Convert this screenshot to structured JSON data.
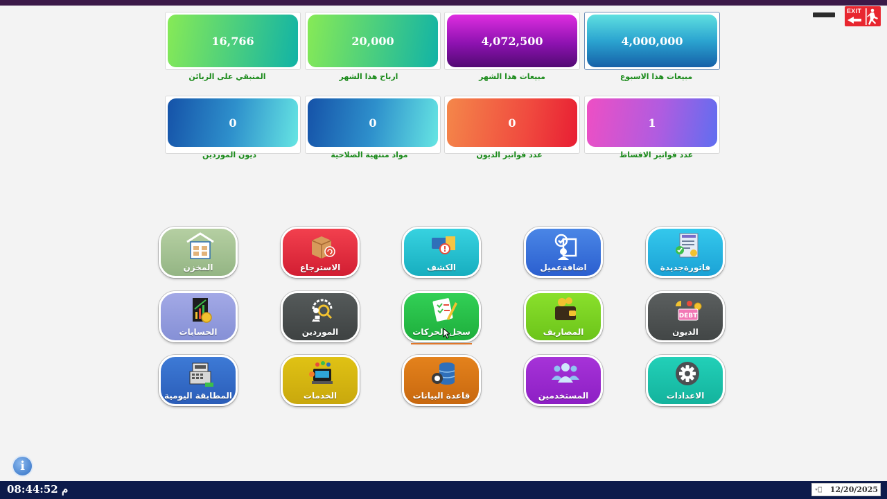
{
  "window": {
    "exit_label": "EXIT"
  },
  "stats": [
    {
      "value": "16,766",
      "label": "المتبقي على الزبائن"
    },
    {
      "value": "20,000",
      "label": "ارباح هذا الشهر"
    },
    {
      "value": "4,072,500",
      "label": "مبيعات هذا الشهر"
    },
    {
      "value": "4,000,000",
      "label": "مبيعات هذا الاسبوع"
    },
    {
      "value": "0",
      "label": "ديون الموردين"
    },
    {
      "value": "0",
      "label": "مواد منتهية الصلاحية"
    },
    {
      "value": "0",
      "label": "عدد فواتير الديون"
    },
    {
      "value": "1",
      "label": "عدد فواتير الاقساط"
    }
  ],
  "modules": {
    "warehouse": "المخزن",
    "returns": "الاسترجاع",
    "statement": "الكشف",
    "add_customer": "اضافةعميل",
    "new_invoice": "فاتورةجديدة",
    "accounts": "الحسابات",
    "suppliers": "الموردين",
    "transactions_log": "سجل الحركات",
    "expenses": "المصاريف",
    "debts": "الديون",
    "daily_reconciliation": "المطابقة اليومية",
    "services": "الخدمات",
    "database": "قاعدة البيانات",
    "users": "المستخدمين",
    "settings": "الاعدادات"
  },
  "icons": {
    "debt_badge": "DEBT"
  },
  "status_bar": {
    "time": "08:44:52",
    "ampm": "م",
    "date": "12/20/2025"
  },
  "colors": {
    "title_bar": "#3b1948",
    "status_bar": "#0d1b4b",
    "stat_label": "#1a8a1a"
  }
}
